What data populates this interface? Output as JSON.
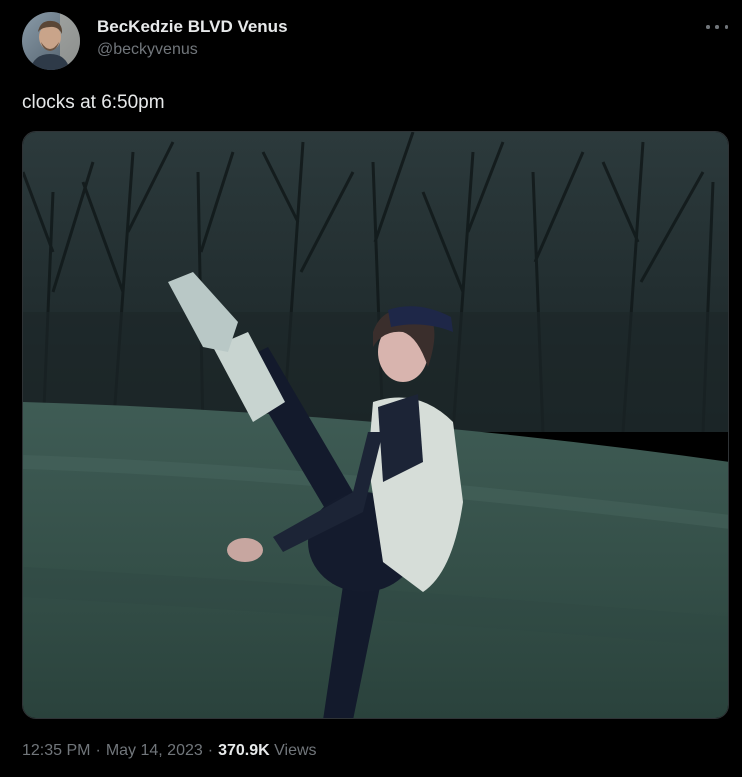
{
  "author": {
    "display_name": "BecKedzie BLVD Venus",
    "handle": "@beckyvenus"
  },
  "tweet": {
    "text": "clocks at 6:50pm"
  },
  "meta": {
    "time": "12:35 PM",
    "separator": "·",
    "date": "May 14, 2023",
    "views_count": "370.9K",
    "views_label": "Views"
  },
  "icons": {
    "more": "more-horizontal-icon"
  },
  "colors": {
    "background": "#000000",
    "text_primary": "#e7e9ea",
    "text_secondary": "#71767b",
    "border": "#2f3336"
  }
}
